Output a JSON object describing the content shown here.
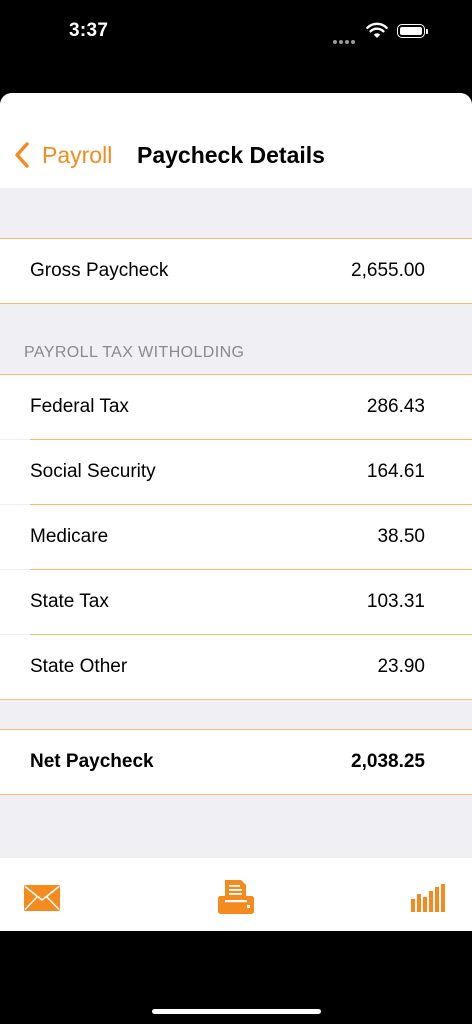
{
  "status_bar": {
    "time": "3:37"
  },
  "nav": {
    "back_label": "Payroll",
    "title": "Paycheck Details"
  },
  "gross": {
    "label": "Gross Paycheck",
    "value": "2,655.00"
  },
  "withholding": {
    "header": "PAYROLL TAX WITHOLDING",
    "items": [
      {
        "label": "Federal Tax",
        "value": "286.43"
      },
      {
        "label": "Social Security",
        "value": "164.61"
      },
      {
        "label": "Medicare",
        "value": "38.50"
      },
      {
        "label": "State Tax",
        "value": "103.31"
      },
      {
        "label": "State Other",
        "value": "23.90"
      }
    ]
  },
  "net": {
    "label": "Net Paycheck",
    "value": "2,038.25"
  },
  "tab_bar": {
    "icons": [
      "envelope-icon",
      "printer-icon",
      "bar-chart-icon"
    ]
  },
  "colors": {
    "accent": "#f58a1e",
    "background": "#efeff4",
    "separator": "#f7b97a"
  }
}
